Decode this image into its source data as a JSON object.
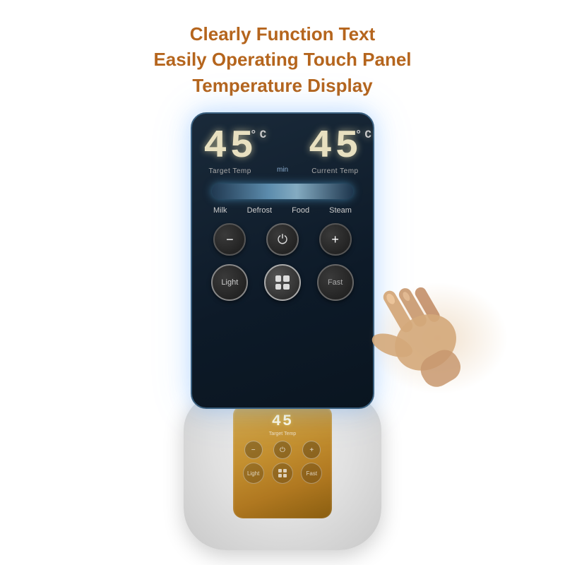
{
  "header": {
    "line1": "Clearly Function Text",
    "line2": "Easily Operating Touch Panel",
    "line3": "Temperature Display",
    "color": "#b5651d"
  },
  "panel": {
    "target_temp": "45",
    "current_temp": "45",
    "degree_symbol": "°C",
    "min_label": "min",
    "target_label": "Target Temp",
    "current_label": "Current Temp",
    "modes": [
      "Milk",
      "Defrost",
      "Food",
      "Steam"
    ],
    "buttons": {
      "minus_label": "−",
      "power_label": "⏻",
      "plus_label": "+",
      "light_label": "Light",
      "fast_label": "Fast"
    }
  },
  "gold_panel": {
    "temp": "45",
    "target_label": "Target Temp",
    "minus": "−",
    "power": "⏻",
    "plus": "+",
    "light": "Light",
    "fast": "Fast"
  }
}
